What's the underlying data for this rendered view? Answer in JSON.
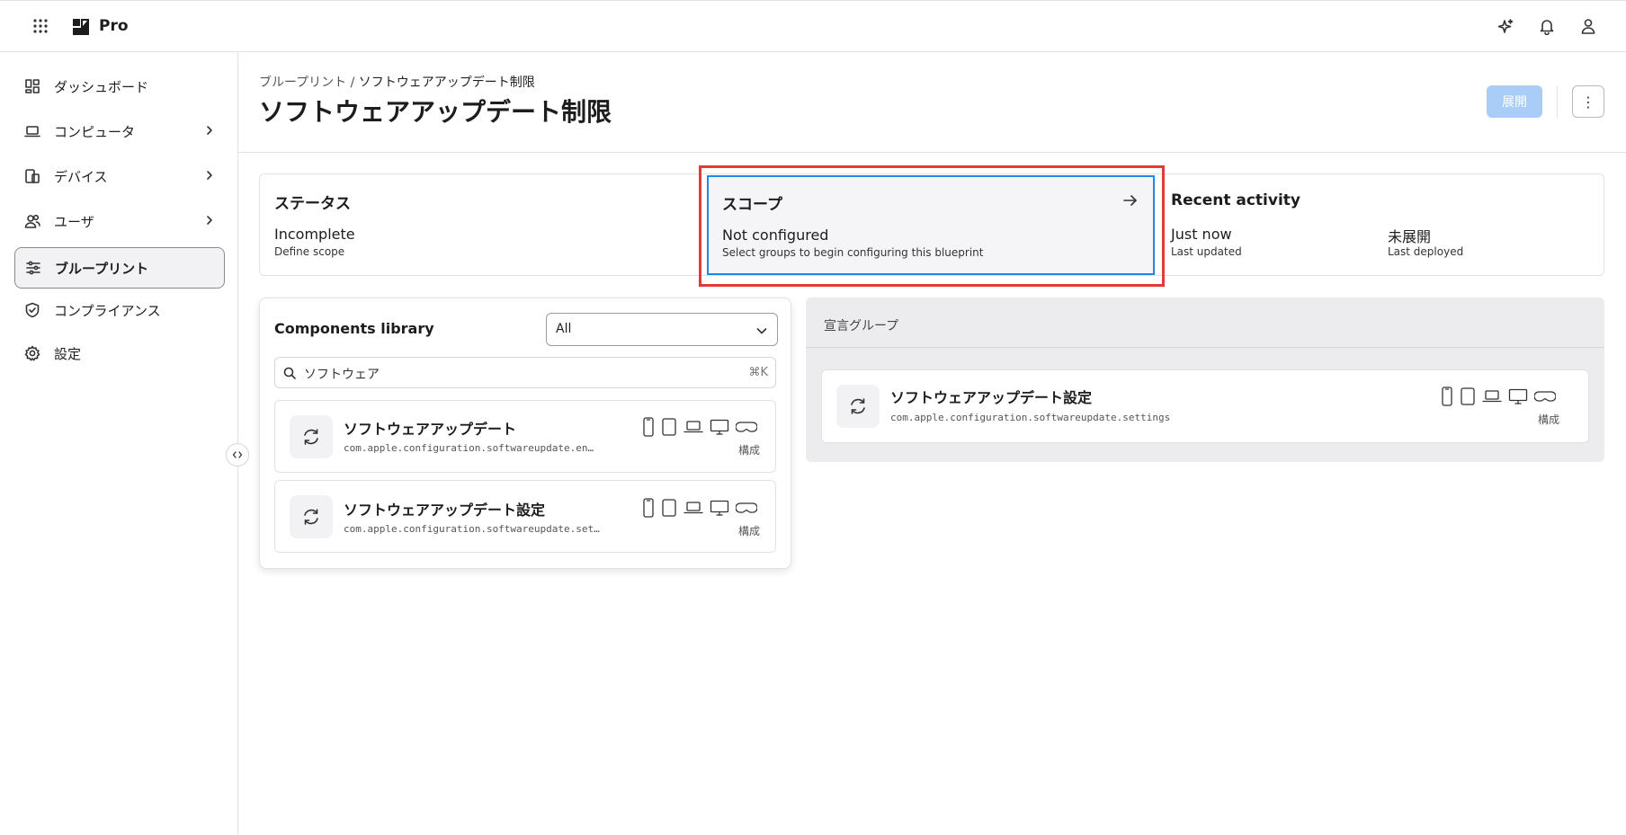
{
  "app": {
    "brand": "Pro"
  },
  "sidebar": {
    "items": [
      {
        "label": "ダッシュボード",
        "icon": "dashboard-icon",
        "chevron": false
      },
      {
        "label": "コンピュータ",
        "icon": "laptop-icon",
        "chevron": true
      },
      {
        "label": "デバイス",
        "icon": "devices-icon",
        "chevron": true
      },
      {
        "label": "ユーザ",
        "icon": "users-icon",
        "chevron": true
      },
      {
        "label": "ブループリント",
        "icon": "sliders-icon",
        "chevron": false,
        "active": true
      },
      {
        "label": "コンプライアンス",
        "icon": "shield-check-icon",
        "chevron": false
      },
      {
        "label": "設定",
        "icon": "gear-icon",
        "chevron": false
      }
    ]
  },
  "header": {
    "breadcrumb_parent": "ブループリント",
    "breadcrumb_sep": " / ",
    "breadcrumb_current": "ソフトウェアアップデート制限",
    "title": "ソフトウェアアップデート制限",
    "deploy_label": "展開",
    "more_label": "⋮"
  },
  "status": {
    "title": "ステータス",
    "value": "Incomplete",
    "sub": "Define scope"
  },
  "scope": {
    "title": "スコープ",
    "value": "Not configured",
    "sub": "Select groups to begin configuring this blueprint"
  },
  "activity": {
    "title": "Recent activity",
    "updated_value": "Just now",
    "updated_label": "Last updated",
    "deployed_value": "未展開",
    "deployed_label": "Last deployed"
  },
  "library": {
    "title": "Components library",
    "filter_value": "All",
    "search_value": "ソフトウェア",
    "search_shortcut": "⌘K",
    "items": [
      {
        "name": "ソフトウェアアップデート",
        "id": "com.apple.configuration.softwareupdate.enforc…",
        "tag": "構成"
      },
      {
        "name": "ソフトウェアアップデート設定",
        "id": "com.apple.configuration.softwareupdate.settings",
        "tag": "構成"
      }
    ]
  },
  "declaration_group": {
    "title": "宣言グループ",
    "items": [
      {
        "name": "ソフトウェアアップデート設定",
        "id": "com.apple.configuration.softwareupdate.settings",
        "tag": "構成"
      }
    ]
  },
  "colors": {
    "accent": "#1e88e5",
    "deploy_disabled": "#a9cdf6",
    "highlight": "#e53935"
  }
}
